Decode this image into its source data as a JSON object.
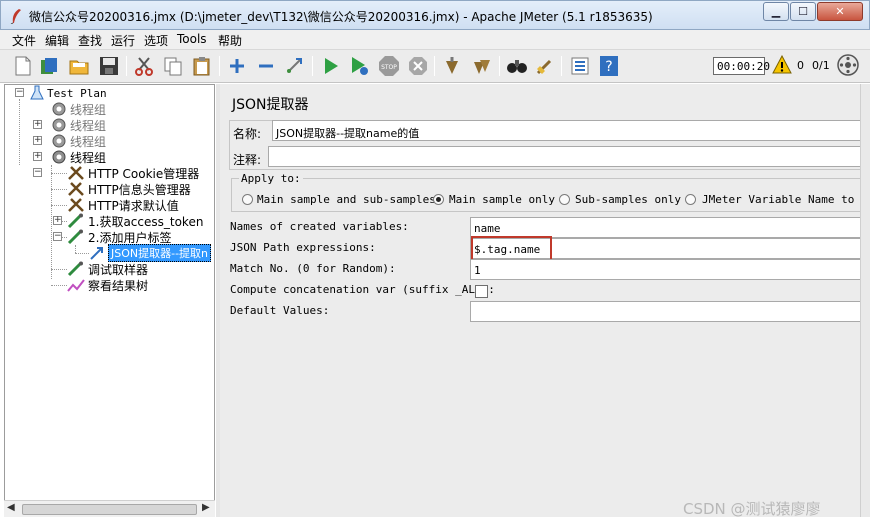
{
  "window": {
    "title": "微信公众号20200316.jmx (D:\\jmeter_dev\\T132\\微信公众号20200316.jmx) - Apache JMeter (5.1 r1853635)",
    "minimize_icon": "minimize-icon",
    "maximize_icon": "maximize-icon",
    "close_icon": "close-icon"
  },
  "menubar": {
    "items": [
      "文件",
      "编辑",
      "查找",
      "运行",
      "选项",
      "Tools",
      "帮助"
    ]
  },
  "toolbar": {
    "icons": [
      "new-icon",
      "templates-icon",
      "open-icon",
      "save-icon",
      "cut-icon",
      "copy-icon",
      "paste-icon",
      "expand-icon",
      "collapse-icon",
      "toggle-icon",
      "start-icon",
      "start-no-pause-icon",
      "stop-icon",
      "shutdown-icon",
      "clear-icon",
      "clear-all-icon",
      "search-icon",
      "reset-search-icon",
      "function-helper-icon",
      "help-icon"
    ],
    "timer": "00:00:20",
    "warning_count": "0",
    "thread_count": "0/1"
  },
  "tree": {
    "root": "Test Plan",
    "thread_groups": [
      "线程组",
      "线程组",
      "线程组",
      "线程组"
    ],
    "children": [
      "HTTP Cookie管理器",
      "HTTP信息头管理器",
      "HTTP请求默认值",
      "1.获取access_token",
      "2.添加用户标签",
      "JSON提取器--提取n",
      "调试取样器",
      "察看结果树"
    ]
  },
  "panel": {
    "heading": "JSON提取器",
    "name_label": "名称:",
    "name_value": "JSON提取器--提取name的值",
    "comment_label": "注释:",
    "comment_value": "",
    "apply_to_label": "Apply to:",
    "apply_options": [
      "Main sample and sub-samples",
      "Main sample only",
      "Sub-samples only",
      "JMeter Variable Name to use"
    ],
    "selected_option": "Main sample only",
    "var_names_label": "Names of created variables:",
    "var_names_value": "name",
    "json_path_label": "JSON Path expressions:",
    "json_path_value": "$.tag.name",
    "match_label": "Match No. (0 for Random):",
    "match_value": "1",
    "concat_label": "Compute concatenation var (suffix _ALL):",
    "concat_checked": false,
    "default_label": "Default Values:",
    "default_value": ""
  },
  "watermark": "CSDN @测试猿廖廖",
  "colors": {
    "selection": "#3399ff",
    "highlight_box": "#c0392b",
    "warning": "#f5c400"
  }
}
